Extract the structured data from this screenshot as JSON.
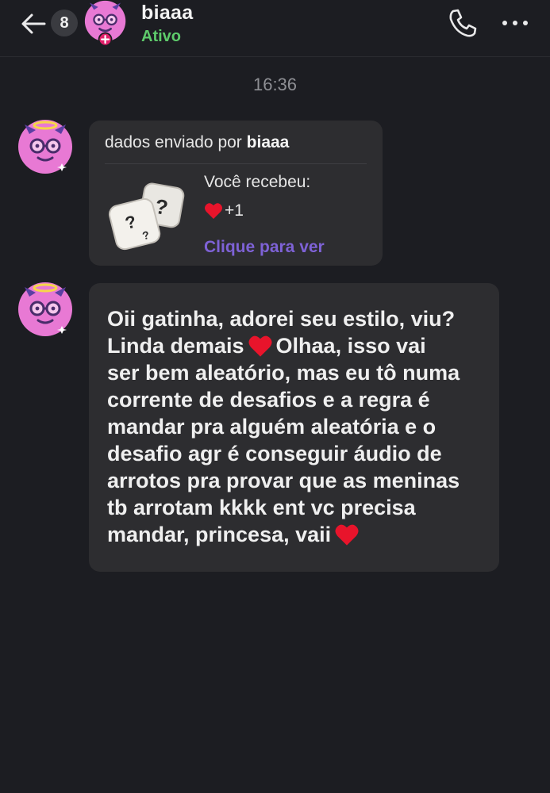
{
  "header": {
    "unread_count": "8",
    "contact_name": "biaaa",
    "status": "Ativo"
  },
  "chat": {
    "timestamp": "16:36",
    "dice_message": {
      "sent_by_prefix": "dados enviado por",
      "sender": "biaaa",
      "received_label": "Você recebeu:",
      "reward_value": "+1",
      "view_link": "Clique para ver"
    },
    "text_message": {
      "line1": "Oii gatinha, adorei seu estilo, viu?",
      "line2a": "Linda demais",
      "line2b": "Olhaa, isso vai",
      "line3": "ser bem aleatório, mas eu tô numa",
      "line4": "corrente de desafios e a regra é",
      "line5": "mandar pra alguém aleatória e o",
      "line6": "desafio agr é conseguir áudio de",
      "line7": "arrotos pra provar que as meninas",
      "line8": "tb arrotam kkkk ent vc precisa",
      "line9": "mandar, princesa, vaii"
    }
  },
  "icons": {
    "back": "arrow-left-icon",
    "call": "phone-icon",
    "more": "more-dots-icon",
    "heart": "red-heart-icon",
    "dice": "mystery-dice-icon"
  },
  "colors": {
    "background": "#1c1d22",
    "bubble": "#2d2d30",
    "status_green": "#5ecb6b",
    "link_purple": "#7e62d6",
    "heart_red": "#e8142b",
    "avatar_pink": "#e879d4"
  }
}
